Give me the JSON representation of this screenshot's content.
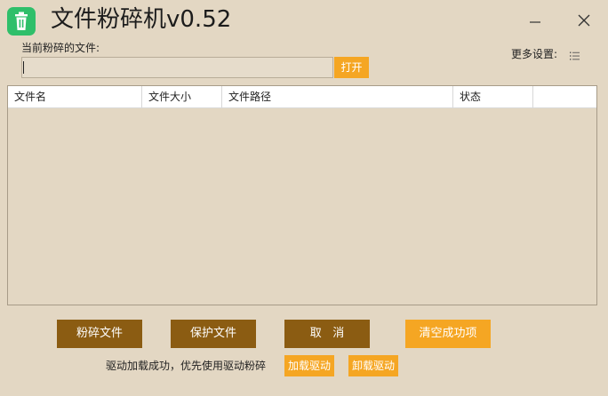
{
  "window": {
    "title": "文件粉碎机v0.52",
    "icon": "trash-icon",
    "accent_color": "#2fbf6a"
  },
  "file_picker": {
    "label": "当前粉碎的文件:",
    "value": "",
    "open_label": "打开"
  },
  "settings": {
    "label": "更多设置:",
    "icon": "list-icon"
  },
  "table": {
    "columns": [
      "文件名",
      "文件大小",
      "文件路径",
      "状态",
      ""
    ],
    "rows": []
  },
  "actions": {
    "shred_label": "粉碎文件",
    "protect_label": "保护文件",
    "cancel_label": "取   消",
    "clear_label": "清空成功项"
  },
  "driver": {
    "status": "驱动加载成功，优先使用驱动粉碎",
    "load_label": "加载驱动",
    "unload_label": "卸载驱动"
  },
  "colors": {
    "background": "#e3d7c3",
    "button_brown": "#8b5c12",
    "button_orange": "#f5a623"
  }
}
